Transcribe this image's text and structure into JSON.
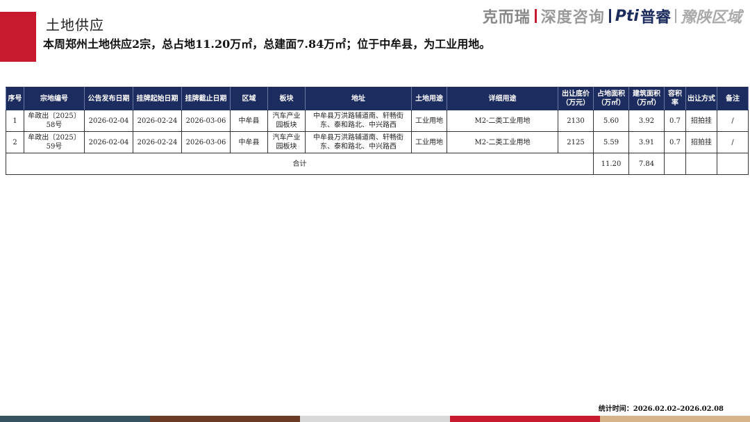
{
  "header": {
    "title": "土地供应",
    "subtitle": "本周郑州土地供应2宗，总占地11.20万㎡，总建面7.84万㎡；位于中牟县，为工业用地。"
  },
  "logo": {
    "brand1": "克而瑞",
    "brand2": "深度咨询",
    "brand3_latin": "Pti",
    "brand3_cn": "普睿",
    "region": "豫陕区域"
  },
  "table": {
    "headers": [
      "序号",
      "宗地编号",
      "公告发布日期",
      "挂牌起始日期",
      "挂牌截止日期",
      "区域",
      "板块",
      "地址",
      "土地用途",
      "详细用途",
      "出让底价（万元）",
      "占地面积（万㎡）",
      "建筑面积（万㎡）",
      "容积率",
      "出让方式",
      "备注"
    ],
    "rows": [
      [
        "1",
        "牟政出〔2025〕58号",
        "2026-02-04",
        "2026-02-24",
        "2026-03-06",
        "中牟县",
        "汽车产业园板块",
        "中牟县万洪路辅道南、轩畅街东、泰和路北、中兴路西",
        "工业用地",
        "M2-二类工业用地",
        "2130",
        "5.60",
        "3.92",
        "0.7",
        "招拍挂",
        "/"
      ],
      [
        "2",
        "牟政出〔2025〕59号",
        "2026-02-04",
        "2026-02-24",
        "2026-03-06",
        "中牟县",
        "汽车产业园板块",
        "中牟县万洪路辅道南、轩畅街东、泰和路北、中兴路西",
        "工业用地",
        "M2-二类工业用地",
        "2125",
        "5.59",
        "3.91",
        "0.7",
        "招拍挂",
        "/"
      ]
    ],
    "total": {
      "label": "合计",
      "land_area": "11.20",
      "building_area": "7.84"
    }
  },
  "footnote": "统计时间：2026.02.02–2026.02.08",
  "colors": {
    "accent_red": "#c8192e",
    "header_navy": "#1d2c5e",
    "bottom_bar": [
      "#34525f",
      "#6b3a25",
      "#d9d9d9",
      "#c8192e",
      "#d8b48a"
    ]
  }
}
